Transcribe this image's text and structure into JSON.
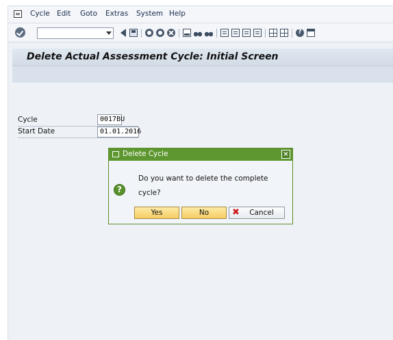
{
  "menubar": {
    "items": [
      "Cycle",
      "Edit",
      "Goto",
      "Extras",
      "System",
      "Help"
    ]
  },
  "toolbar": {
    "command_field_value": ""
  },
  "screen": {
    "title": "Delete Actual Assessment Cycle: Initial Screen"
  },
  "form": {
    "cycle_label": "Cycle",
    "cycle_value": "0017BU",
    "start_date_label": "Start Date",
    "start_date_value": "01.01.2016"
  },
  "dialog": {
    "title": "Delete Cycle",
    "message": "Do you want to delete the complete cycle?",
    "yes_label": "Yes",
    "no_label": "No",
    "cancel_label": "Cancel"
  },
  "colors": {
    "dialog_title_bg": "#5e9730",
    "button_yellow": "#f6cd63",
    "cancel_icon": "#cc1a1a"
  }
}
